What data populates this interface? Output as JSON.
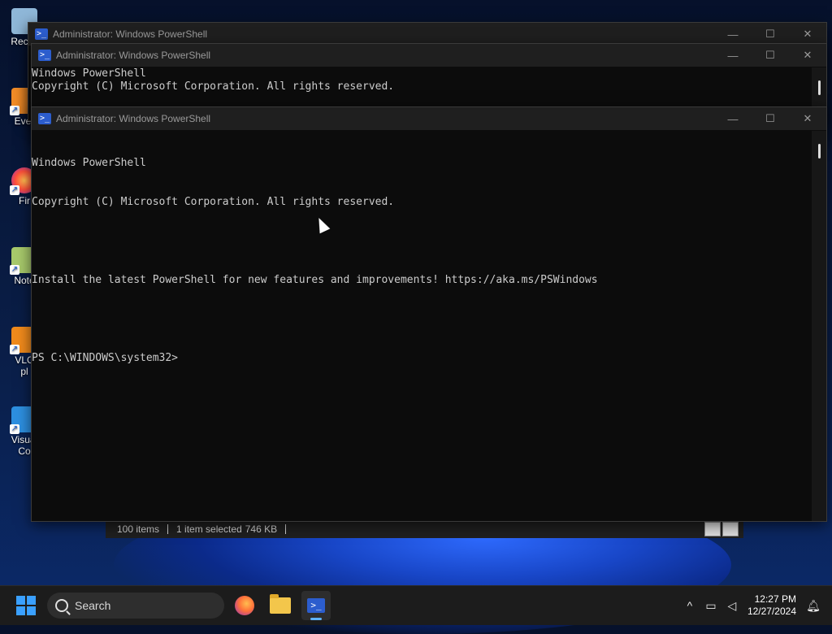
{
  "desktop": {
    "icons": [
      {
        "label": "Recyc",
        "icon": "recycle-bin-icon"
      },
      {
        "label": "Ever",
        "icon": "everything-icon"
      },
      {
        "label": "Fir",
        "icon": "firefox-icon"
      },
      {
        "label": "Note",
        "icon": "notepad-icon"
      },
      {
        "label": "VLC\npl",
        "icon": "vlc-icon"
      },
      {
        "label": "Visual\nCo",
        "icon": "vscode-icon"
      }
    ]
  },
  "windows": [
    {
      "title": "Administrator: Windows PowerShell",
      "lines": []
    },
    {
      "title": "Administrator: Windows PowerShell",
      "lines": [
        "Windows PowerShell",
        "Copyright (C) Microsoft Corporation. All rights reserved."
      ]
    },
    {
      "title": "Administrator: Windows PowerShell",
      "lines": [
        "Windows PowerShell",
        "Copyright (C) Microsoft Corporation. All rights reserved.",
        "",
        "Install the latest PowerShell for new features and improvements! https://aka.ms/PSWindows",
        "",
        "PS C:\\WINDOWS\\system32>"
      ]
    }
  ],
  "window_controls": {
    "minimize": "—",
    "maximize": "☐",
    "close": "✕"
  },
  "explorer_status": {
    "items": "100 items",
    "selected": "1 item selected",
    "size": "746 KB"
  },
  "taskbar": {
    "search_placeholder": "Search",
    "apps": [
      "firefox-icon",
      "file-explorer-icon",
      "powershell-icon"
    ],
    "clock_time": "12:27 PM",
    "clock_date": "12/27/2024"
  },
  "colors": {
    "console_bg": "#0c0c0c",
    "console_text": "#cccccc",
    "titlebar": "#1f1f1f",
    "taskbar": "#1c1c1c",
    "accent": "#3aa0ff"
  }
}
